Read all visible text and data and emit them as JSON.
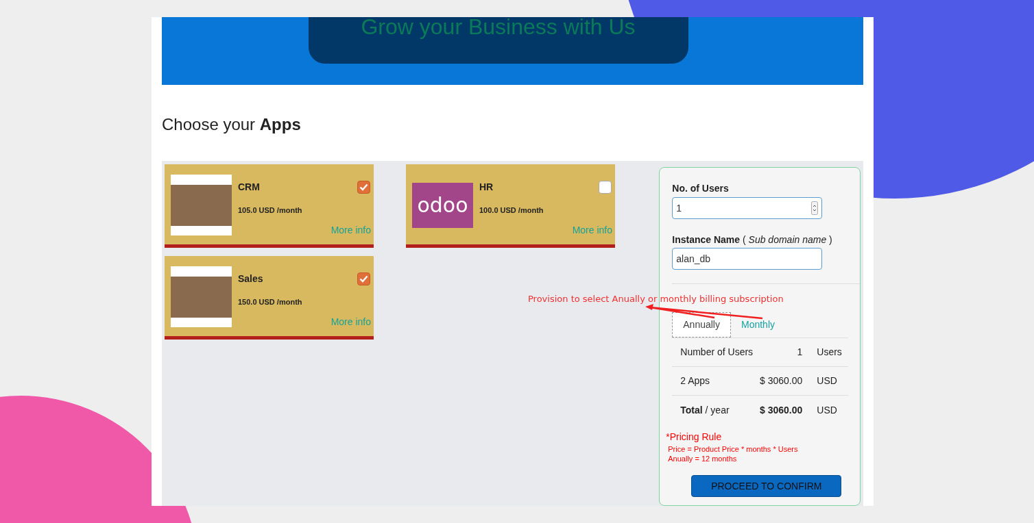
{
  "banner": {
    "title": "Grow your Business with Us"
  },
  "heading": "Choose your **Apps**",
  "apps": [
    {
      "name": "CRM",
      "price": "105.0 USD /month",
      "link": "More info",
      "checked": true,
      "kind": "photo"
    },
    {
      "name": "HR",
      "price": "100.0 USD /month",
      "link": "More info",
      "checked": false,
      "kind": "logo",
      "logo_text": "odoo"
    },
    {
      "name": "Sales",
      "price": "150.0 USD /month",
      "link": "More info",
      "checked": true,
      "kind": "photo"
    }
  ],
  "form": {
    "users_label": "No. of Users",
    "users_value": "1",
    "instance_label": "**Instance Name** ( *Sub domain name* )",
    "instance_value": "alan_db"
  },
  "billing_tabs": [
    {
      "label": "Annually",
      "selected": true
    },
    {
      "label": "Monthly",
      "selected": false
    }
  ],
  "summary": [
    {
      "label": "Number of Users",
      "value": "1",
      "unit": "Users",
      "kind": "plain"
    },
    {
      "label": "2 Apps",
      "value": "$ 3060.00",
      "unit": "USD",
      "kind": "plain"
    },
    {
      "label": "**Total** / year",
      "value": "$ 3060.00",
      "unit": "USD",
      "kind": "total"
    }
  ],
  "pricing_rule": {
    "title": "*Pricing Rule",
    "lines": [
      "Price = Product Price * months * Users",
      "Anually = 12 months"
    ]
  },
  "confirm_button": "PROCEED TO CONFIRM",
  "annotation": "Provision to select Anually or monthly billing subscription"
}
